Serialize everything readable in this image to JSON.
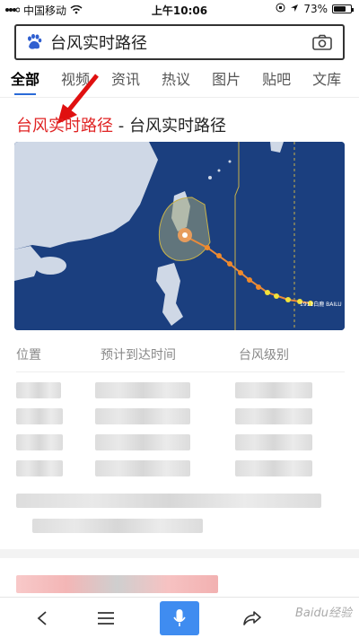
{
  "status_bar": {
    "carrier": "中国移动",
    "time": "上午10:06",
    "battery_percent": "73%",
    "battery_level": 0.73
  },
  "search": {
    "query": "台风实时路径"
  },
  "tabs": [
    {
      "label": "全部"
    },
    {
      "label": "视频"
    },
    {
      "label": "资讯"
    },
    {
      "label": "热议"
    },
    {
      "label": "图片"
    },
    {
      "label": "贴吧"
    },
    {
      "label": "文库"
    }
  ],
  "result": {
    "title_highlight": "台风实时路径",
    "title_rest": " - 台风实时路径",
    "map_label": "1911白鹿 BAILU"
  },
  "table": {
    "headers": [
      "位置",
      "预计到达时间",
      "台风级别"
    ]
  },
  "bottom_nav": {
    "back_icon": "back-icon",
    "menu_icon": "menu-icon",
    "mic_icon": "mic-icon",
    "share_icon": "share-icon"
  },
  "watermark": "Baidu经验",
  "colors": {
    "accent": "#3f8cf0",
    "highlight_red": "#e02424",
    "map_sea": "#1b3f7f"
  }
}
